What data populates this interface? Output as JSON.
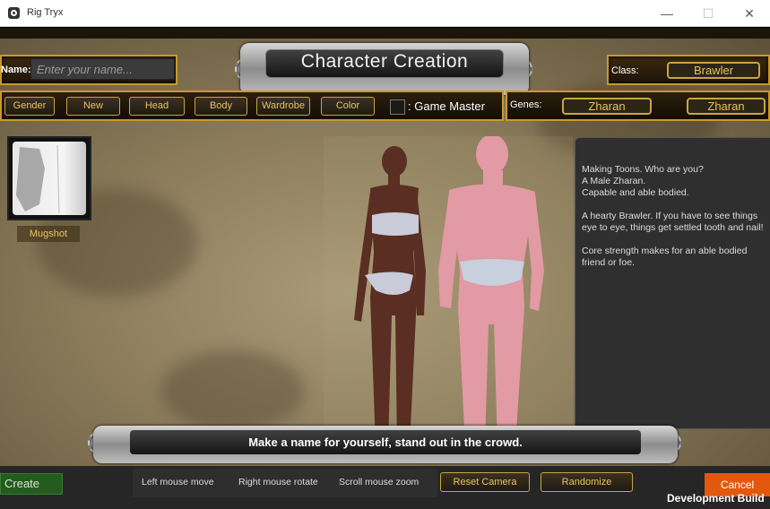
{
  "window": {
    "title": "Rig Tryx",
    "minimize": "—",
    "maximize": "☐",
    "close": "✕"
  },
  "header": {
    "title": "Character Creation",
    "name_label": "Name:",
    "name_placeholder": "Enter your name...",
    "class_label": "Class:",
    "class_value": "Brawler"
  },
  "toolbar": {
    "buttons": [
      "Gender",
      "New",
      "Head",
      "Body",
      "Wardrobe",
      "Color"
    ],
    "game_master_label": ": Game Master"
  },
  "genes": {
    "label": "Genes:",
    "values": [
      "Zharan",
      "Zharan"
    ]
  },
  "mugshot": {
    "label": "Mugshot"
  },
  "info": {
    "paragraphs": [
      [
        "Making Toons. Who are you?",
        "A Male Zharan.",
        "Capable and able bodied."
      ],
      [
        "A hearty Brawler. If you have to see things eye to eye, things get settled tooth and nail!"
      ],
      [
        "Core strength makes for an able bodied friend or foe."
      ]
    ]
  },
  "bottom": {
    "message": "Make a name for yourself, stand out in the crowd."
  },
  "controls": {
    "create": "Create",
    "hint_left": "Left mouse move",
    "hint_right": "Right mouse rotate",
    "hint_scroll": "Scroll mouse zoom",
    "reset_camera": "Reset Camera",
    "randomize": "Randomize",
    "cancel": "Cancel",
    "dev_build": "Development Build"
  },
  "colors": {
    "gold": "#c9a541",
    "create_green": "#255b1f",
    "cancel_orange": "#e2590d"
  }
}
